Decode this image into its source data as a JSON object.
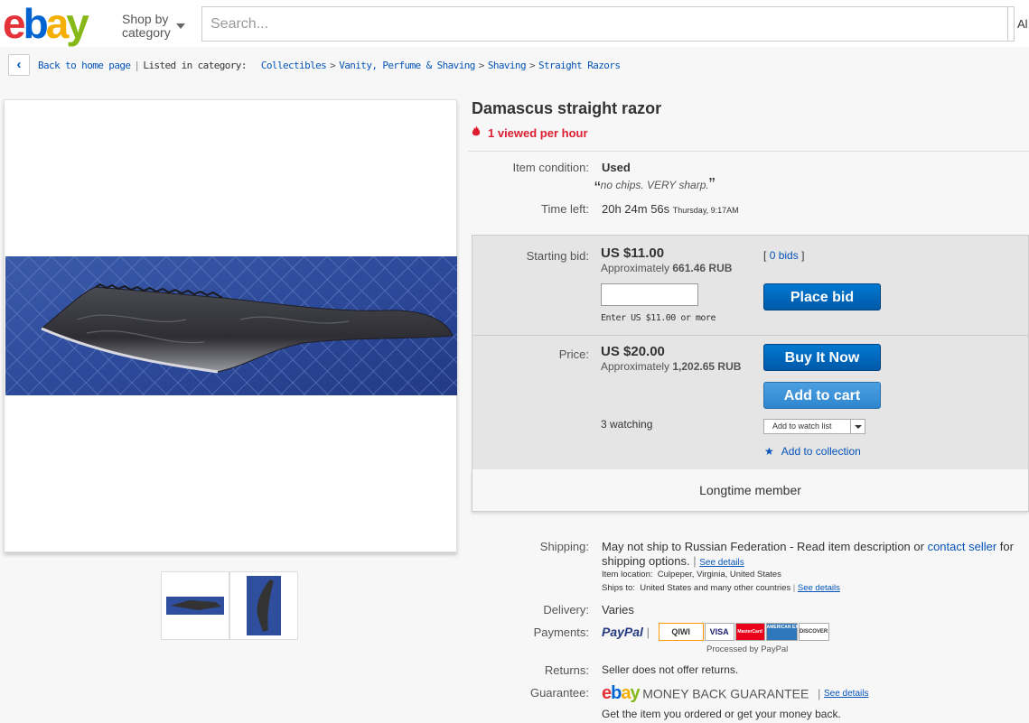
{
  "header": {
    "logo": {
      "e": "e",
      "b": "b",
      "a": "a",
      "y": "y"
    },
    "shop_by_line1": "Shop by",
    "shop_by_line2": "category",
    "search_placeholder": "Search...",
    "search_category": "Al"
  },
  "breadcrumb": {
    "back_icon": "chevron-left-icon",
    "back_label": "Back to home page",
    "listed_label": "Listed in category:",
    "items": [
      "Collectibles",
      "Vanity, Perfume & Shaving",
      "Shaving",
      "Straight Razors"
    ],
    "separator": ">"
  },
  "item": {
    "title": "Damascus straight razor",
    "viewed": "1 viewed per hour",
    "condition_label": "Item condition:",
    "condition": "Used",
    "condition_quote": "no chips. VERY sharp.",
    "time_left_label": "Time left:",
    "time_left": "20h 24m 56s",
    "time_left_end": "Thursday, 9:17AM"
  },
  "bid": {
    "starting_label": "Starting bid:",
    "starting_price": "US $11.00",
    "approx_prefix": "Approximately",
    "starting_approx": "661.46 RUB",
    "bids_link": "0 bids",
    "bids_open": "[",
    "bids_close": "]",
    "enter_hint": "Enter US $11.00 or more",
    "place_bid": "Place bid",
    "price_label": "Price:",
    "price": "US $20.00",
    "price_approx": "1,202.65 RUB",
    "buy_now": "Buy It Now",
    "add_to_cart": "Add to cart",
    "watching": "3 watching",
    "add_watch": "Add to watch list",
    "add_collection": "Add to collection",
    "member": "Longtime member"
  },
  "shipping": {
    "label": "Shipping:",
    "text1": "May not ship to Russian Federation - Read item description or",
    "contact": "contact seller",
    "text2": "for",
    "text3": "shipping options.",
    "see_details": "See details",
    "location_label": "Item location:",
    "location": "Culpeper, Virginia, United States",
    "ships_label": "Ships to:",
    "ships": "United States and many other countries",
    "delivery_label": "Delivery:",
    "delivery": "Varies",
    "payments_label": "Payments:",
    "paypal": "PayPal",
    "badges": [
      "QIWI",
      "VISA",
      "MasterCard",
      "AMERICAN EXPRESS",
      "DISCOVER"
    ],
    "processed": "Processed by PayPal",
    "returns_label": "Returns:",
    "returns": "Seller does not offer returns.",
    "guarantee_label": "Guarantee:",
    "guarantee_text": "MONEY BACK GUARANTEE",
    "guarantee_note": "Get the item you ordered or get your money back."
  },
  "colors": {
    "link": "#0654ba",
    "hot": "#dd1e31",
    "button": "#0068c3"
  }
}
